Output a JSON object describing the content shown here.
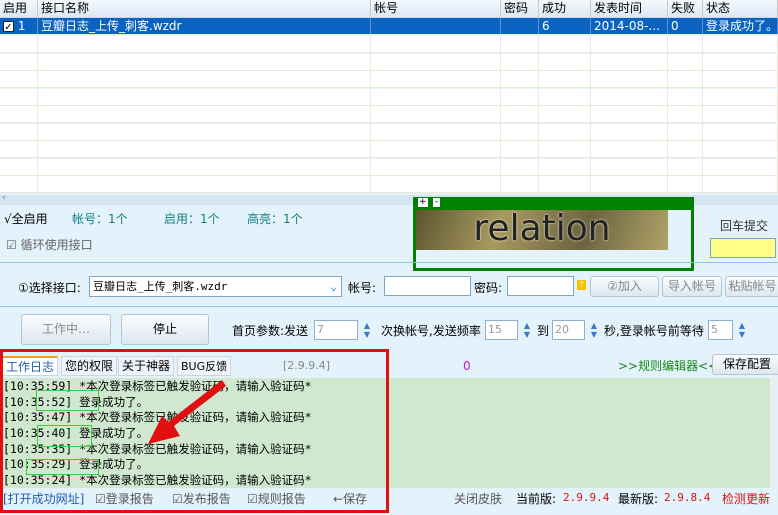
{
  "table": {
    "headers": [
      "启用",
      "接口名称",
      "帐号",
      "密码",
      "成功",
      "发表时间",
      "失败",
      "状态"
    ],
    "rows": [
      {
        "checked": true,
        "index": "1",
        "name": "豆瓣日志_上传_刺客.wzdr",
        "account": "",
        "password": "",
        "success": "6",
        "time": "2014-08-...",
        "fail": "0",
        "status": "登录成功了。"
      }
    ]
  },
  "stats": {
    "enable_all": "√全启用",
    "accounts": "帐号：1个",
    "enabled": "启用：1个",
    "highlight": "高亮：1个",
    "loop_label": "循环使用接口"
  },
  "captcha": {
    "text": "relation",
    "plus": "+",
    "minus": "-",
    "submit_label": "回车提交"
  },
  "interface": {
    "select_label": "①选择接口:",
    "selected": "豆瓣日志_上传_刺客.wzdr",
    "account_label": "帐号:",
    "password_label": "密码:",
    "add": "②加入",
    "import": "导入帐号",
    "paste": "粘贴帐号"
  },
  "controls": {
    "working": "工作中…",
    "stop": "停止",
    "p1": "首页参数:发送",
    "v1": "7",
    "p2": "次换帐号,发送频率",
    "v2": "15",
    "p3": "到",
    "v3": "20",
    "p4": "秒,登录帐号前等待",
    "v4": "5"
  },
  "tabs": [
    "工作日志",
    "您的权限",
    "关于神器",
    "BUG反馈"
  ],
  "version_tag": "[2.9.9.4]",
  "counter": "0",
  "rule_editor": ">>规则编辑器<<",
  "save_config": "保存配置",
  "log": [
    "[10:35:59] *本次登录标签已触发验证码，请输入验证码*",
    "[10:35:52] 登录成功了。",
    "[10:35:47] *本次登录标签已触发验证码，请输入验证码*",
    "[10:35:40] 登录成功了。",
    "[10:35:35] *本次登录标签已触发验证码，请输入验证码*",
    "[10:35:29] 登录成功了。",
    "[10:35:24] *本次登录标签已触发验证码，请输入验证码*"
  ],
  "footer": {
    "open_url": "[打开成功网址]",
    "login_report": "登录报告",
    "publish_report": "发布报告",
    "rule_report": "规则报告",
    "save": "←保存",
    "close_skin": "关闭皮肤",
    "current_label": "当前版:",
    "current": "2.9.9.4",
    "latest_label": "最新版:",
    "latest": "2.9.8.4",
    "check_update": "检测更新"
  },
  "colors": {
    "selection": "#0a63c0",
    "log_bg": "#cfe8cf",
    "annotation": "#e01010"
  }
}
